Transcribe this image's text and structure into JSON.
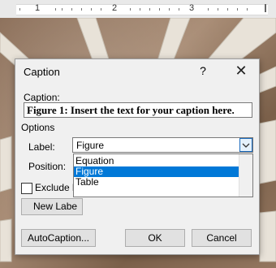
{
  "ruler": {
    "numbers": [
      "1",
      "2",
      "3"
    ]
  },
  "dialog": {
    "title": "Caption",
    "help_icon": "?",
    "close_icon": "✕",
    "caption_label": "Caption:",
    "caption_value": "Figure 1: Insert the text for your caption here.",
    "options_label": "Options",
    "label_label": "Label:",
    "label_value": "Figure",
    "position_label": "Position:",
    "label_options": [
      "Equation",
      "Figure",
      "Table"
    ],
    "selected_option": "Figure",
    "exclude_label": "Exclude l",
    "new_label_button": "New Labe",
    "autocaption_button": "AutoCaption...",
    "ok_button": "OK",
    "cancel_button": "Cancel"
  },
  "colors": {
    "selection": "#0078d7",
    "dialog_bg": "#f0f0f0"
  }
}
